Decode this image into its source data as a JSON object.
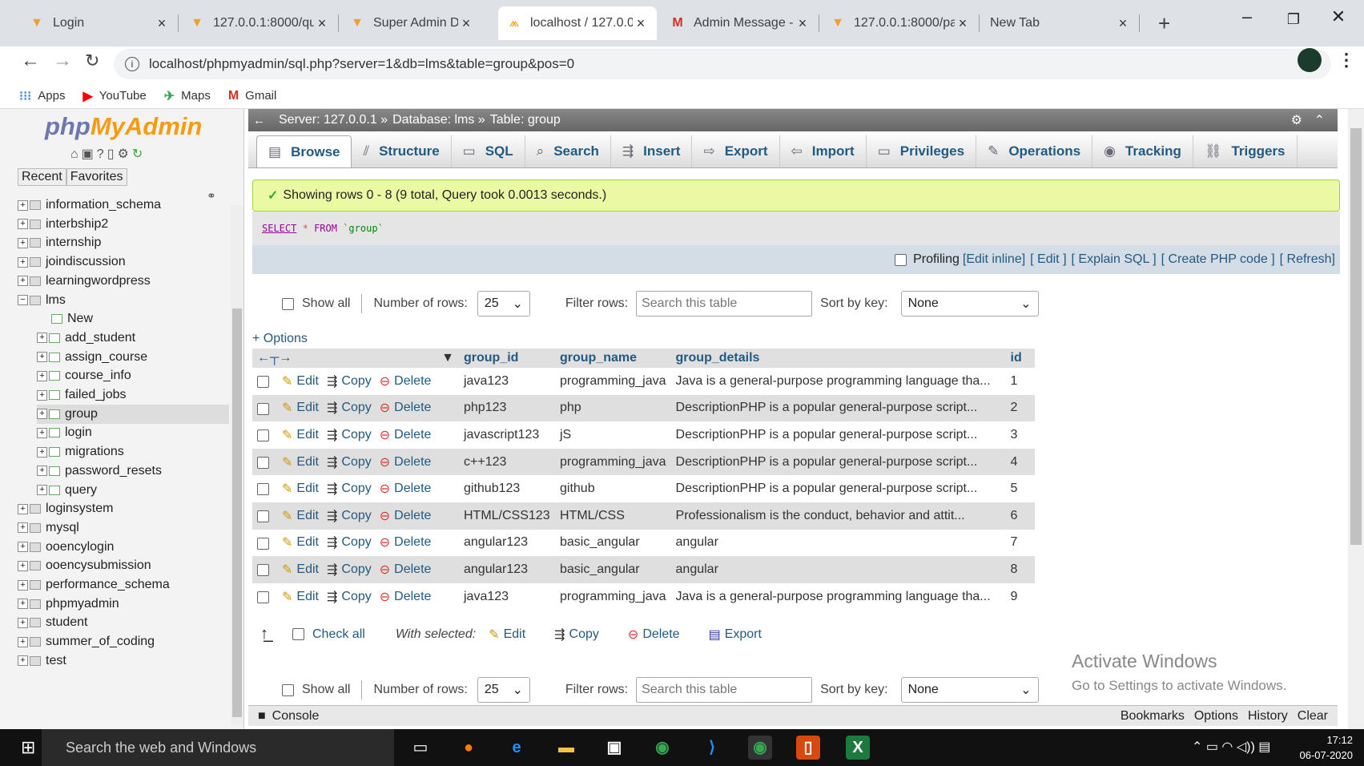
{
  "browser": {
    "tabs": [
      {
        "title": "Login",
        "icon": "triangle-down-icon",
        "color": "#f0a030"
      },
      {
        "title": "127.0.0.1:8000/qu",
        "icon": "triangle-down-icon",
        "color": "#f0a030"
      },
      {
        "title": "Super Admin Dash",
        "icon": "triangle-down-icon",
        "color": "#f0a030"
      },
      {
        "title": "localhost / 127.0.0",
        "icon": "pma-icon",
        "color": "#f89c0e"
      },
      {
        "title": "Admin Message -",
        "icon": "gmail-icon",
        "color": "#d93025"
      },
      {
        "title": "127.0.0.1:8000/pa",
        "icon": "triangle-down-icon",
        "color": "#f0a030"
      },
      {
        "title": "New Tab",
        "icon": "",
        "color": ""
      }
    ],
    "new_tab": "+",
    "url": "localhost/phpmyadmin/sql.php?server=1&db=lms&table=group&pos=0",
    "bookmarks": [
      "Apps",
      "YouTube",
      "Maps",
      "Gmail"
    ]
  },
  "left": {
    "logo_a": "php",
    "logo_b": "MyAdmin",
    "recent": "Recent",
    "favorites": "Favorites",
    "tree": [
      {
        "label": "information_schema",
        "level": 0
      },
      {
        "label": "interbship2",
        "level": 0
      },
      {
        "label": "internship",
        "level": 0
      },
      {
        "label": "joindiscussion",
        "level": 0
      },
      {
        "label": "learningwordpress",
        "level": 0
      },
      {
        "label": "lms",
        "level": 0
      },
      {
        "label": "New",
        "level": 1
      },
      {
        "label": "add_student",
        "level": 1
      },
      {
        "label": "assign_course",
        "level": 1
      },
      {
        "label": "course_info",
        "level": 1
      },
      {
        "label": "failed_jobs",
        "level": 1
      },
      {
        "label": "group",
        "level": 1
      },
      {
        "label": "login",
        "level": 1
      },
      {
        "label": "migrations",
        "level": 1
      },
      {
        "label": "password_resets",
        "level": 1
      },
      {
        "label": "query",
        "level": 1
      },
      {
        "label": "loginsystem",
        "level": 0
      },
      {
        "label": "mysql",
        "level": 0
      },
      {
        "label": "ooencylogin",
        "level": 0
      },
      {
        "label": "ooencysubmission",
        "level": 0
      },
      {
        "label": "performance_schema",
        "level": 0
      },
      {
        "label": "phpmyadmin",
        "level": 0
      },
      {
        "label": "student",
        "level": 0
      },
      {
        "label": "summer_of_coding",
        "level": 0
      },
      {
        "label": "test",
        "level": 0
      }
    ]
  },
  "breadcrumb": {
    "server": "Server: 127.0.0.1 »",
    "database": "Database: lms »",
    "table": "Table: group"
  },
  "tabs": [
    {
      "label": "Browse",
      "icon": "▤"
    },
    {
      "label": "Structure",
      "icon": "⫽"
    },
    {
      "label": "SQL",
      "icon": "▭"
    },
    {
      "label": "Search",
      "icon": "⌕"
    },
    {
      "label": "Insert",
      "icon": "⇶"
    },
    {
      "label": "Export",
      "icon": "⇨"
    },
    {
      "label": "Import",
      "icon": "⇦"
    },
    {
      "label": "Privileges",
      "icon": "▭"
    },
    {
      "label": "Operations",
      "icon": "✎"
    },
    {
      "label": "Tracking",
      "icon": "◉"
    },
    {
      "label": "Triggers",
      "icon": "⛓"
    }
  ],
  "success": "Showing rows 0 - 8 (9 total, Query took 0.0013 seconds.)",
  "sql": {
    "kw1": "SELECT",
    "star": "*",
    "kw2": "FROM",
    "tbl": "`group`"
  },
  "profiling": {
    "label": "Profiling",
    "links": [
      "[Edit inline]",
      "[ Edit ]",
      "[ Explain SQL ]",
      "[ Create PHP code ]",
      "[ Refresh]"
    ]
  },
  "controls": {
    "show_all": "Show all",
    "rows_label": "Number of rows:",
    "rows_value": "25",
    "filter_label": "Filter rows:",
    "filter_placeholder": "Search this table",
    "sort_label": "Sort by key:",
    "sort_value": "None"
  },
  "options": "+ Options",
  "columns": [
    "group_id",
    "group_name",
    "group_details",
    "id"
  ],
  "actions": {
    "edit": "Edit",
    "copy": "Copy",
    "delete": "Delete"
  },
  "rows": [
    [
      "java123",
      "programming_java",
      "Java is a general-purpose programming language tha...",
      "1"
    ],
    [
      "php123",
      "php",
      "DescriptionPHP is a popular general-purpose script...",
      "2"
    ],
    [
      "javascript123",
      "jS",
      "DescriptionPHP is a popular general-purpose script...",
      "3"
    ],
    [
      "c++123",
      "programming_java",
      "DescriptionPHP is a popular general-purpose script...",
      "4"
    ],
    [
      "github123",
      "github",
      "DescriptionPHP is a popular general-purpose script...",
      "5"
    ],
    [
      "HTML/CSS123",
      "HTML/CSS",
      "Professionalism is the conduct, behavior and attit...",
      "6"
    ],
    [
      "angular123",
      "basic_angular",
      "angular",
      "7"
    ],
    [
      "angular123",
      "basic_angular",
      "angular",
      "8"
    ],
    [
      "java123",
      "programming_java",
      "Java is a general-purpose programming language tha...",
      "9"
    ]
  ],
  "with_selected": {
    "check_all": "Check all",
    "label": "With selected:",
    "edit": "Edit",
    "copy": "Copy",
    "delete": "Delete",
    "export": "Export"
  },
  "watermark": {
    "line1": "Activate Windows",
    "line2": "Go to Settings to activate Windows."
  },
  "console": {
    "label": "Console",
    "bookmarks": "Bookmarks",
    "options": "Options",
    "history": "History",
    "clear": "Clear"
  },
  "taskbar": {
    "search": "Search the web and Windows",
    "time": "17:12",
    "date": "06-07-2020"
  }
}
